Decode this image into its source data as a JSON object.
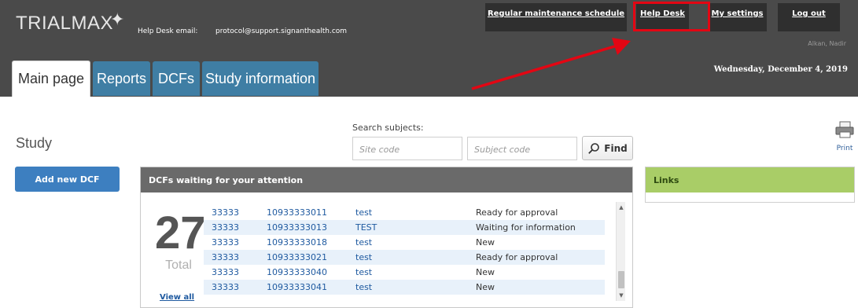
{
  "header": {
    "logo": "TRIALMAX",
    "help_desk_label": "Help Desk email:",
    "help_desk_email": "protocol@support.signanthealth.com",
    "buttons": {
      "maintenance": "Regular maintenance schedule",
      "help_desk": "Help Desk",
      "settings": "My settings",
      "logout": "Log out"
    },
    "user": "Alkan, Nadir",
    "date": "Wednesday, December 4, 2019"
  },
  "tabs": [
    {
      "label": "Main page",
      "active": true
    },
    {
      "label": "Reports",
      "active": false
    },
    {
      "label": "DCFs",
      "active": false
    },
    {
      "label": "Study information",
      "active": false
    }
  ],
  "main": {
    "title": "Study",
    "add_dcf": "Add new DCF",
    "search": {
      "label": "Search subjects:",
      "site_placeholder": "Site code",
      "subject_placeholder": "Subject code",
      "find": "Find"
    },
    "print": "Print"
  },
  "dcf_panel": {
    "title": "DCFs waiting for your attention",
    "count": "27",
    "total_label": "Total",
    "view_all": "View all",
    "rows": [
      {
        "site": "33333",
        "subject": "10933333011",
        "desc": "test",
        "status": "Ready for approval"
      },
      {
        "site": "33333",
        "subject": "10933333013",
        "desc": "TEST",
        "status": "Waiting for information"
      },
      {
        "site": "33333",
        "subject": "10933333018",
        "desc": "test",
        "status": "New"
      },
      {
        "site": "33333",
        "subject": "10933333021",
        "desc": "test",
        "status": "Ready for approval"
      },
      {
        "site": "33333",
        "subject": "10933333040",
        "desc": "test",
        "status": "New"
      },
      {
        "site": "33333",
        "subject": "10933333041",
        "desc": "test",
        "status": "New"
      }
    ]
  },
  "links_panel": {
    "title": "Links"
  },
  "colors": {
    "header_bg": "#4a4a4a",
    "tab_blue": "#3f7ea4",
    "button_blue": "#3d7fc0",
    "links_green": "#a9cd67",
    "highlight_red": "#e30613"
  }
}
